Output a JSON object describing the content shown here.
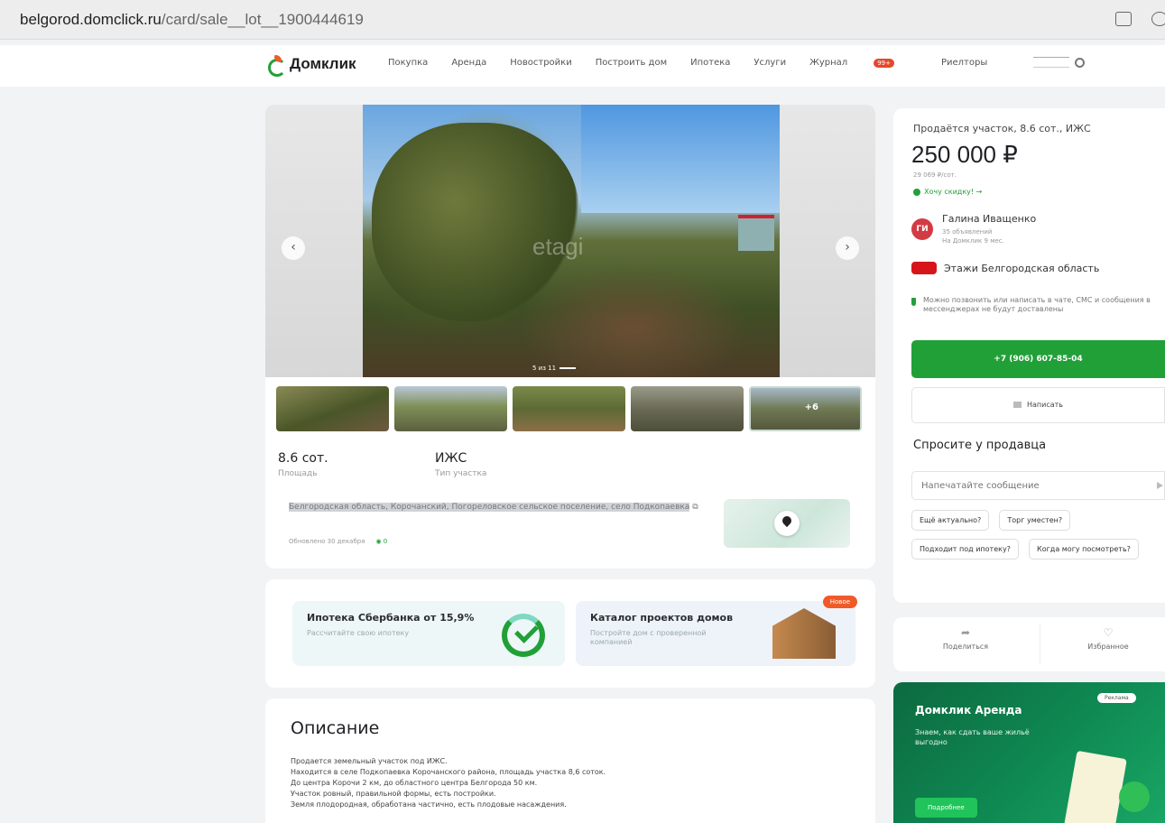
{
  "browser": {
    "host": "belgorod.domclick.ru",
    "path": "/card/sale__lot__1900444619"
  },
  "header": {
    "logo": "Домклик",
    "nav": [
      "Покупка",
      "Аренда",
      "Новостройки",
      "Построить дом",
      "Ипотека",
      "Услуги",
      "Журнал",
      "Риелторы"
    ],
    "journal_badge": "99+"
  },
  "gallery": {
    "watermark": "etagi",
    "counter": "5 из 11",
    "more_photos": "+6"
  },
  "params": [
    {
      "value": "8.6 сот.",
      "label": "Площадь"
    },
    {
      "value": "ИЖС",
      "label": "Тип участка"
    }
  ],
  "address": "Белгородская область, Корочанский, Погореловское сельское поселение, село Подкопаевка",
  "updated": "Обновлено 30 декабря",
  "views": "0",
  "promos": [
    {
      "title": "Ипотека Сбербанка от 15,9%",
      "subtitle": "Рассчитайте свою ипотеку"
    },
    {
      "title": "Каталог проектов домов",
      "subtitle": "Постройте дом с проверенной компанией",
      "badge": "Новое"
    }
  ],
  "description": {
    "heading": "Описание",
    "lines": [
      "Продается земельный участок под ИЖС.",
      "Находится в селе Подкопаевка Корочанского района, площадь участка 8,6 соток.",
      "До центра Корочи 2 км, до областного центра Белгорода 50 км.",
      "Участок ровный, правильной формы, есть постройки.",
      "Земля плодородная, обработана частично, есть плодовые насаждения."
    ]
  },
  "sidebar": {
    "title": "Продаётся участок, 8.6 сот., ИЖС",
    "price": "250 000 ₽",
    "price_per": "29 069 ₽/сот.",
    "discount": "Хочу скидку! →",
    "agent": {
      "initials": "ГИ",
      "name": "Галина Иващенко",
      "ads": "35 объявлений",
      "since": "На Домклик 9 мес."
    },
    "agency": "Этажи Белгородская область",
    "notice": "Можно позвонить или написать в чате, СМС и сообщения в мессенджерах не будут доставлены",
    "phone": "+7 (906) 607-85-04",
    "write": "Написать",
    "ask_title": "Спросите у продавца",
    "input_placeholder": "Напечатайте сообщение",
    "chips": [
      "Ещё актуально?",
      "Торг уместен?",
      "Подходит под ипотеку?",
      "Когда могу посмотреть?"
    ],
    "share": "Поделиться",
    "favorite": "Избранное"
  },
  "rent_ad": {
    "title": "Домклик Аренда",
    "subtitle": "Знаем, как сдать ваше жильё выгодно",
    "ad_label": "Реклама",
    "button": "Подробнее"
  }
}
